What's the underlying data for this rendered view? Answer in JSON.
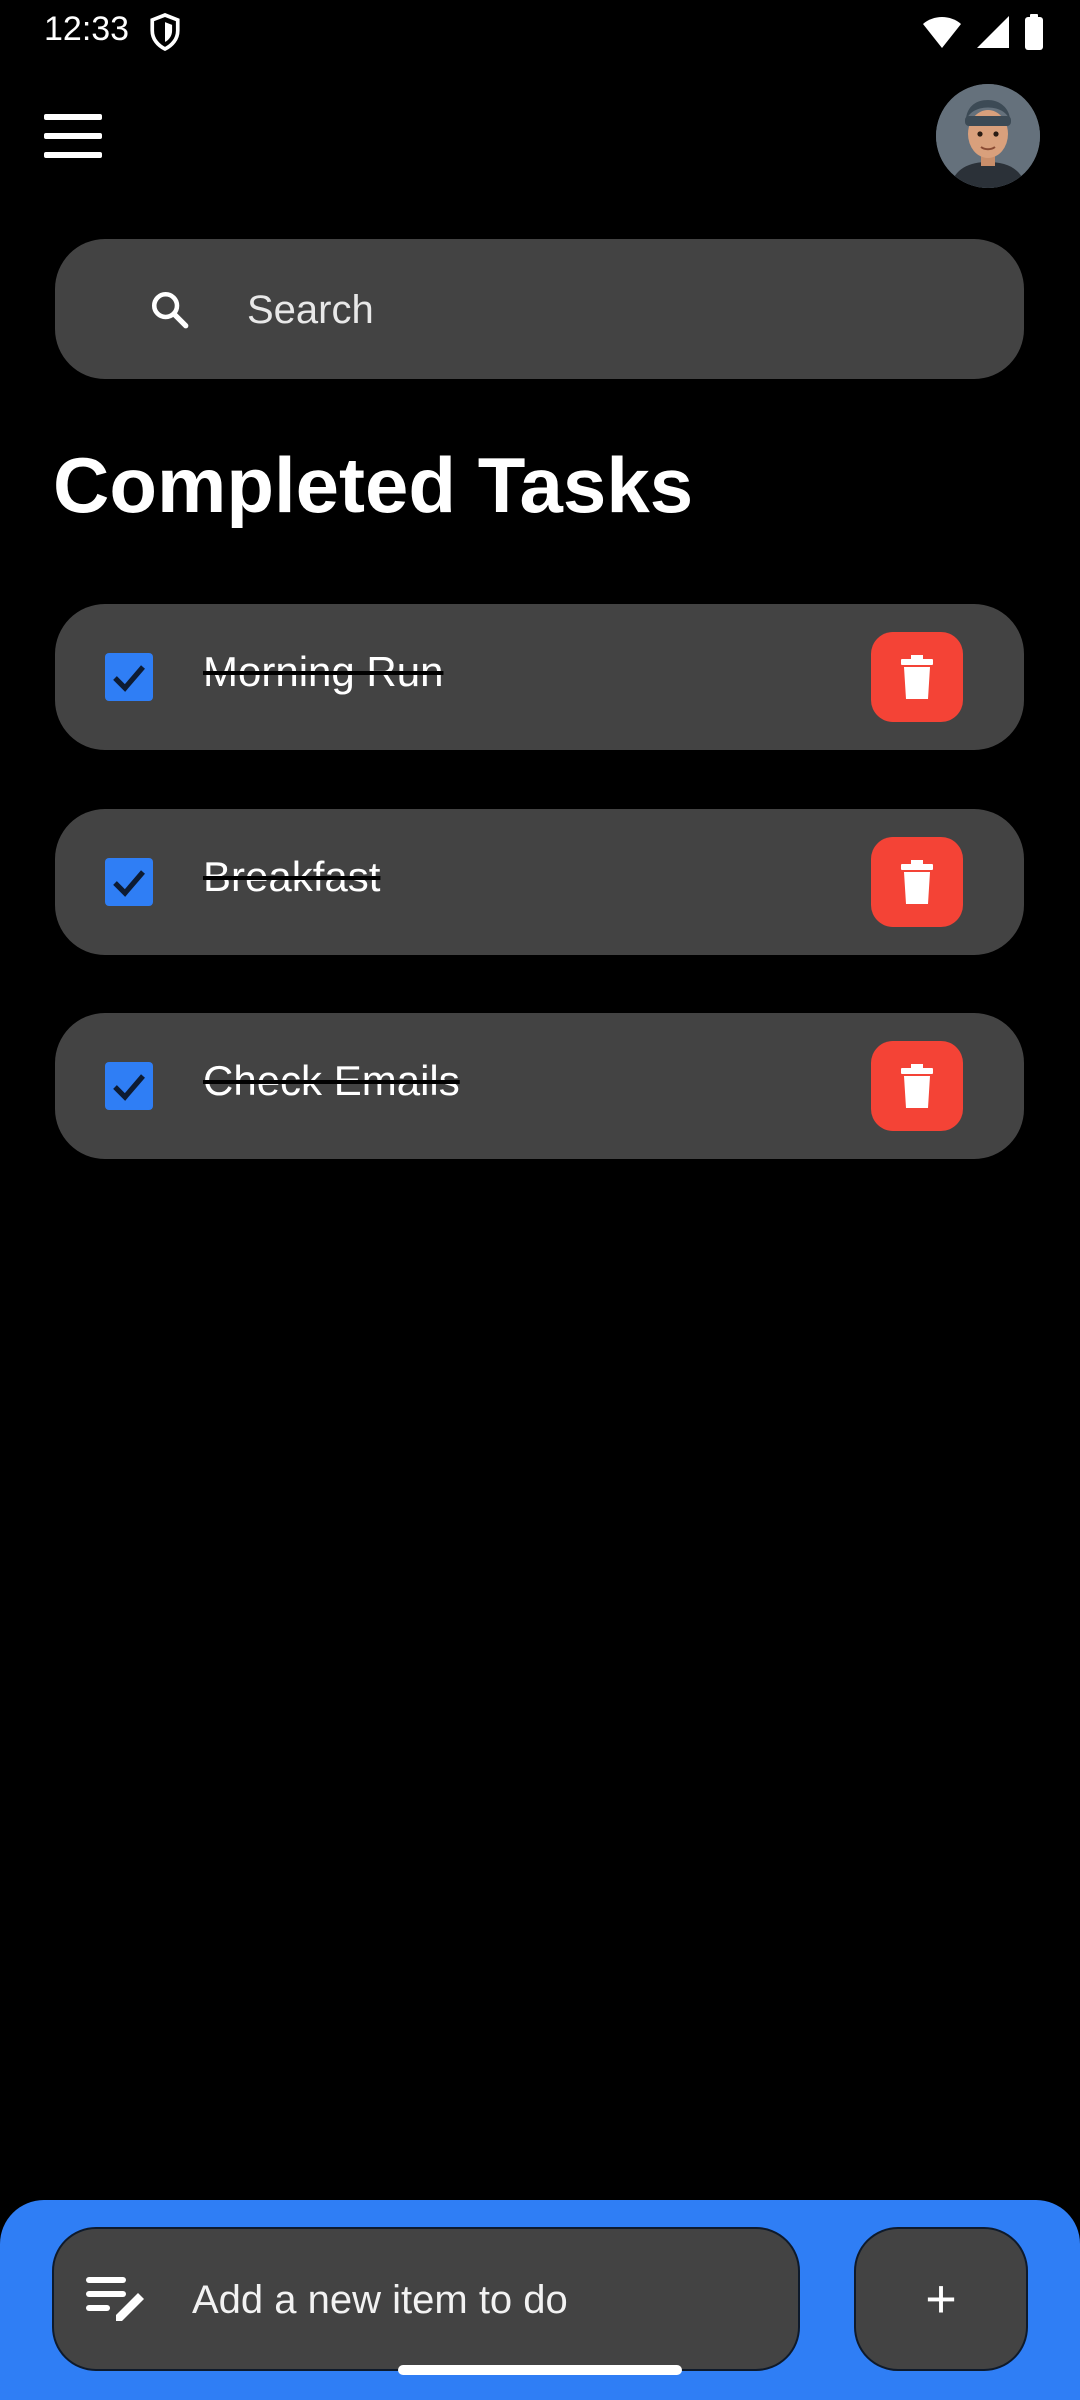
{
  "status_bar": {
    "time": "12:33"
  },
  "header": {
    "menu_icon": "hamburger-menu-icon",
    "avatar_icon": "user-avatar"
  },
  "search": {
    "placeholder": "Search",
    "icon": "search-icon"
  },
  "page": {
    "title": "Completed Tasks"
  },
  "tasks": [
    {
      "label": "Morning Run",
      "checked": true
    },
    {
      "label": "Breakfast",
      "checked": true
    },
    {
      "label": "Check Emails",
      "checked": true
    }
  ],
  "add_bar": {
    "placeholder": "Add a new item to do",
    "add_label": "+",
    "icon": "edit-note-icon"
  },
  "colors": {
    "accent": "#2f7ef5",
    "danger": "#f44336",
    "surface": "#434343",
    "background": "#000000"
  }
}
